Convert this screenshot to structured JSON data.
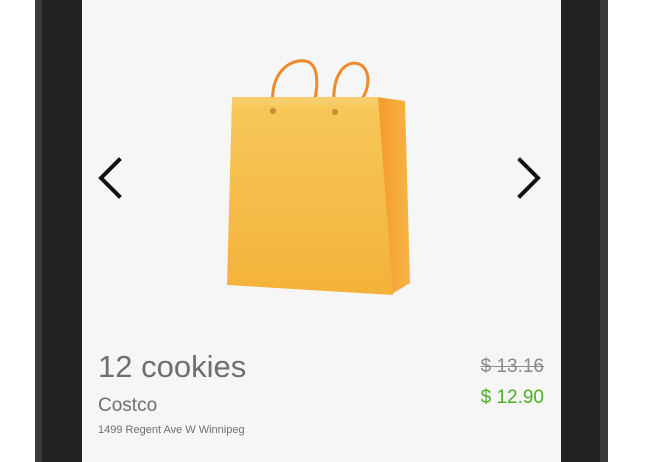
{
  "product": {
    "title": "12 cookies",
    "store": "Costco",
    "address": "1499 Regent Ave W Winnipeg",
    "image_icon": "shopping-bag-icon"
  },
  "pricing": {
    "original": "$ 13.16",
    "current": "$ 12.90",
    "current_color": "#4caf24"
  },
  "navigation": {
    "prev_icon": "chevron-left-icon",
    "next_icon": "chevron-right-icon"
  },
  "theme": {
    "bag_color": "#f6bd45",
    "handle_color": "#ef8a2a",
    "arrow_color": "#111111"
  }
}
